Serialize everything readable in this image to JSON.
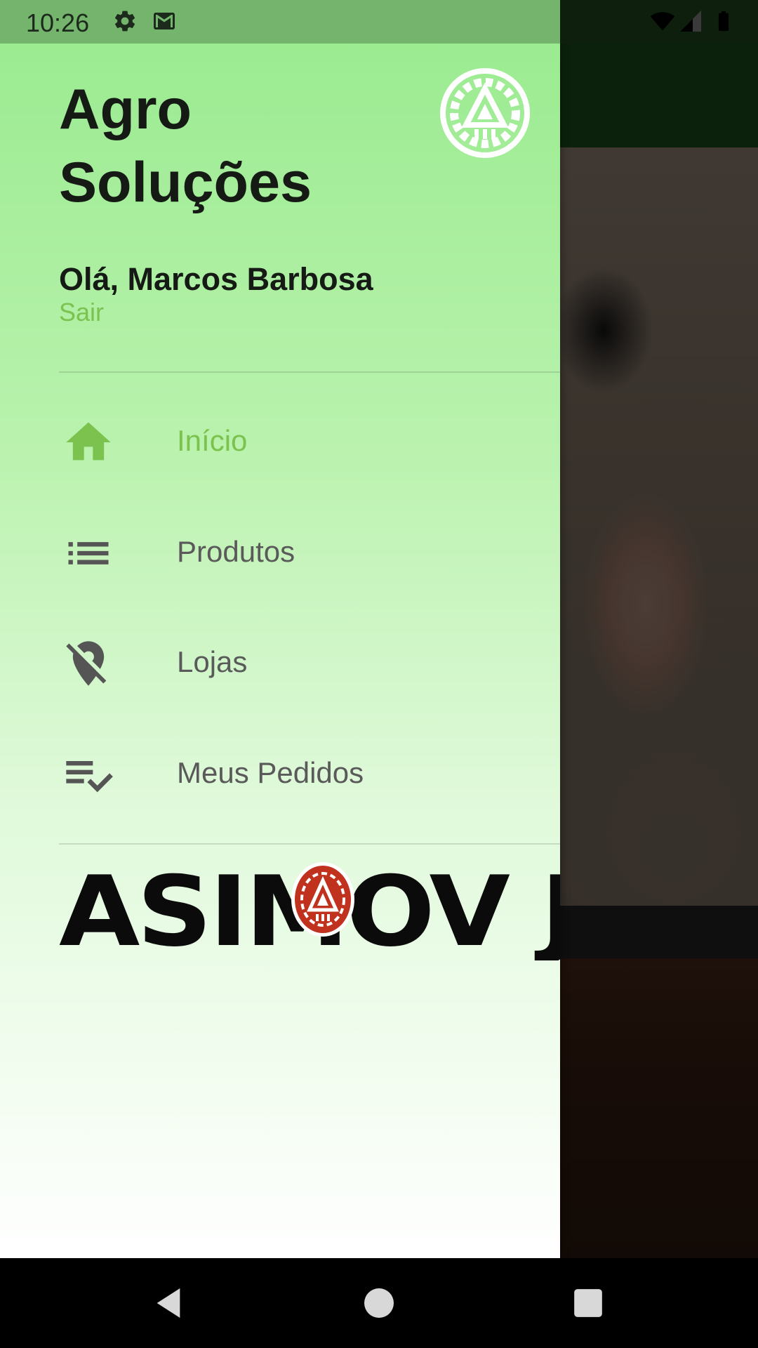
{
  "status_bar": {
    "time": "10:26",
    "icons": [
      "settings-icon",
      "gmail-icon",
      "wifi-icon",
      "signal-icon",
      "battery-icon"
    ]
  },
  "drawer": {
    "title_line1": "Agro",
    "title_line2": "Soluções",
    "greeting": "Olá, Marcos Barbosa",
    "logout_label": "Sair",
    "menu": [
      {
        "label": "Início",
        "icon": "home-icon",
        "active": true
      },
      {
        "label": "Produtos",
        "icon": "list-icon",
        "active": false
      },
      {
        "label": "Lojas",
        "icon": "location-off-icon",
        "active": false
      },
      {
        "label": "Meus Pedidos",
        "icon": "playlist-check-icon",
        "active": false
      }
    ],
    "brand_logo_text": "ASIMOV JR."
  },
  "navigation_bar": {
    "buttons": [
      "back-icon",
      "home-circle-icon",
      "recents-icon"
    ]
  },
  "colors": {
    "accent": "#7bc24e",
    "drawer_top": "#98ea8e",
    "toolbar": "#163a16",
    "logo_red": "#c0321e"
  }
}
